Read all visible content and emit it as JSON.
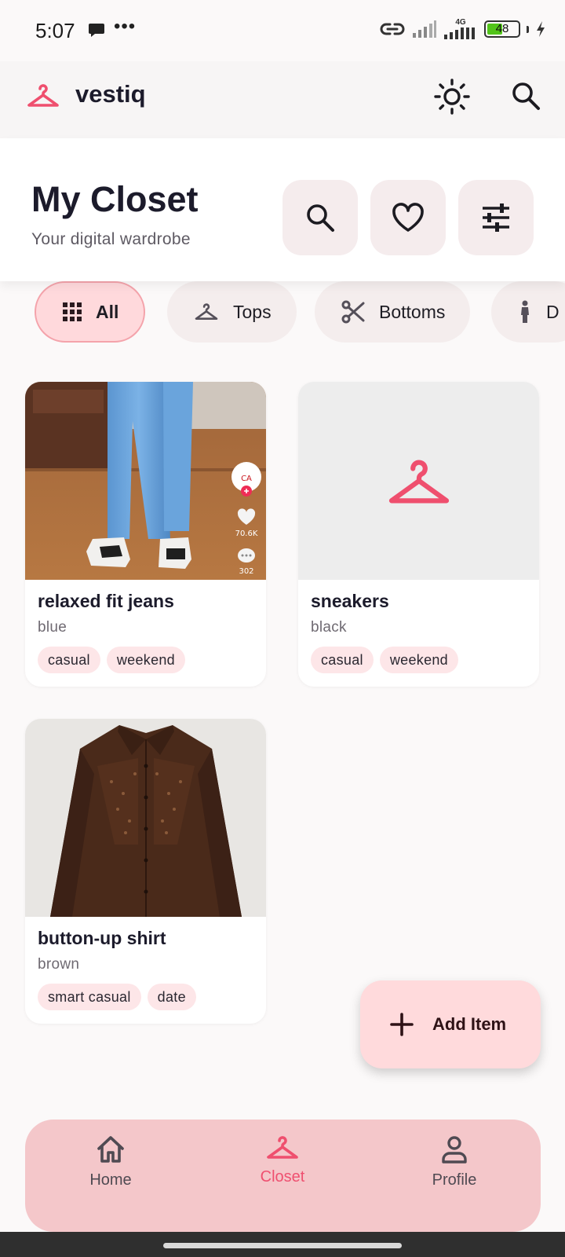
{
  "status_bar": {
    "time": "5:07",
    "dots": "•••",
    "network": "4G",
    "battery": "48",
    "battery_level": 0.48
  },
  "app_bar": {
    "brand": "vestiq",
    "brand_color": "#ef4f6e",
    "icons": [
      "hanger-icon",
      "sun-icon",
      "search-icon"
    ]
  },
  "header": {
    "title": "My Closet",
    "subtitle": "Your digital wardrobe",
    "buttons": [
      "search-icon",
      "heart-icon",
      "tune-icon"
    ]
  },
  "filters": [
    {
      "label": "All",
      "icon": "grid-icon",
      "active": true
    },
    {
      "label": "Tops",
      "icon": "hanger-icon",
      "active": false
    },
    {
      "label": "Bottoms",
      "icon": "scissors-icon",
      "active": false
    },
    {
      "label": "D",
      "icon": "person-icon",
      "active": false
    }
  ],
  "items": [
    {
      "name": "relaxed fit jeans",
      "color": "blue",
      "tags": [
        "casual",
        "weekend"
      ],
      "overlay": {
        "likes": "70.6K",
        "comments": "302"
      }
    },
    {
      "name": "sneakers",
      "color": "black",
      "tags": [
        "casual",
        "weekend"
      ]
    },
    {
      "name": "button-up shirt",
      "color": "brown",
      "tags": [
        "smart casual",
        "date"
      ]
    }
  ],
  "fab": {
    "label": "Add Item"
  },
  "bottom_nav": [
    {
      "label": "Home",
      "icon": "home-icon",
      "active": false
    },
    {
      "label": "Closet",
      "icon": "hanger-icon",
      "active": true
    },
    {
      "label": "Profile",
      "icon": "person-icon",
      "active": false
    }
  ],
  "colors": {
    "accent": "#ef4f6e",
    "chip_active": "#ffd9dc",
    "nav_bg": "#f4c7ca",
    "fab_bg": "#ffdadc"
  }
}
